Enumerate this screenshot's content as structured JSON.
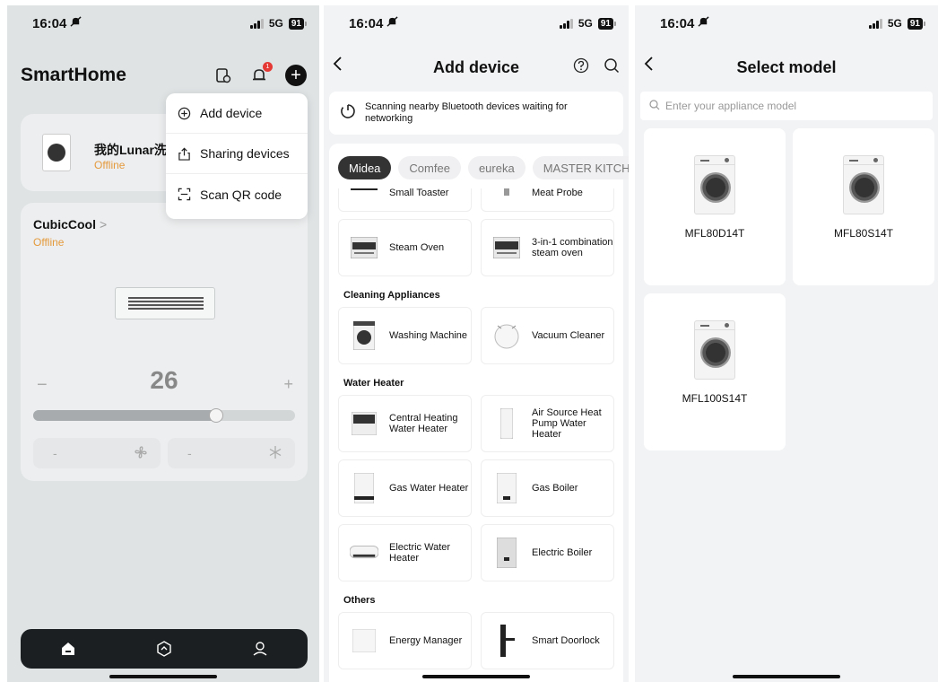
{
  "status": {
    "time": "16:04",
    "network": "5G",
    "battery": "91"
  },
  "screen1": {
    "title": "SmartHome",
    "menu": [
      {
        "label": "Add device",
        "icon": "plus-circle-icon"
      },
      {
        "label": "Sharing devices",
        "icon": "share-icon"
      },
      {
        "label": "Scan QR code",
        "icon": "scan-icon"
      }
    ],
    "device1": {
      "name": "我的Lunar洗",
      "status": "Offline"
    },
    "device2": {
      "name": "CubicCool",
      "chevron": ">",
      "status": "Offline",
      "temperature": "26",
      "minus": "−",
      "plus": "+",
      "slider_fraction": 0.7,
      "mode_left": "-",
      "mode_right": "-"
    }
  },
  "screen2": {
    "title": "Add device",
    "scan_text": "Scanning nearby Bluetooth devices waiting for networking",
    "brands": [
      {
        "label": "Midea",
        "active": true
      },
      {
        "label": "Comfee",
        "active": false
      },
      {
        "label": "eureka",
        "active": false
      },
      {
        "label": "MASTER KITCH",
        "active": false
      }
    ],
    "top_items": [
      "Small Toaster",
      "Meat Probe",
      "Steam Oven",
      "3-in-1 combination steam oven"
    ],
    "categories": [
      {
        "title": "Cleaning Appliances",
        "items": [
          "Washing Machine",
          "Vacuum Cleaner"
        ]
      },
      {
        "title": "Water Heater",
        "items": [
          "Central Heating Water Heater",
          "Air Source Heat Pump Water Heater",
          "Gas Water Heater",
          "Gas Boiler",
          "Electric Water Heater",
          "Electric Boiler"
        ]
      },
      {
        "title": "Others",
        "items": [
          "Energy Manager",
          "Smart  Doorlock"
        ]
      }
    ]
  },
  "screen3": {
    "title": "Select model",
    "search_placeholder": "Enter your appliance model",
    "models": [
      "MFL80D14T",
      "MFL80S14T",
      "MFL100S14T"
    ]
  }
}
